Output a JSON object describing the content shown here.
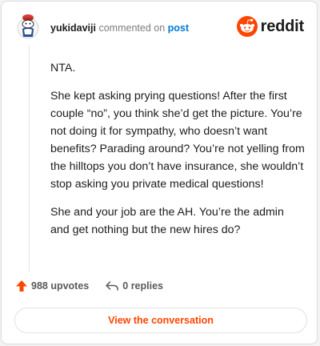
{
  "header": {
    "username": "yukidaviji",
    "action_text": "commented on",
    "post_link": "post",
    "brand_name": "reddit"
  },
  "comment": {
    "paragraphs": [
      "NTA.",
      "She kept asking prying questions! After the first couple “no”, you think she’d get the picture. You’re not doing it for sympathy, who doesn’t want benefits? Parading around? You’re not yelling from the hilltops you don’t have insurance, she wouldn’t stop asking you private medical questions!",
      "She and your job are the AH. You’re the admin and get nothing but the new hires do?"
    ]
  },
  "stats": {
    "upvotes": "988 upvotes",
    "replies": "0 replies"
  },
  "cta": {
    "label": "View the conversation"
  },
  "colors": {
    "brand_orange": "#ff4500",
    "link_blue": "#0079d3",
    "text_dark": "#1c1c1c",
    "text_muted": "#7c7c7c"
  },
  "icons": {
    "avatar": "snoo-avatar",
    "brand": "reddit-logo-icon",
    "upvote": "upvote-arrow-icon",
    "reply": "reply-arrow-icon"
  }
}
